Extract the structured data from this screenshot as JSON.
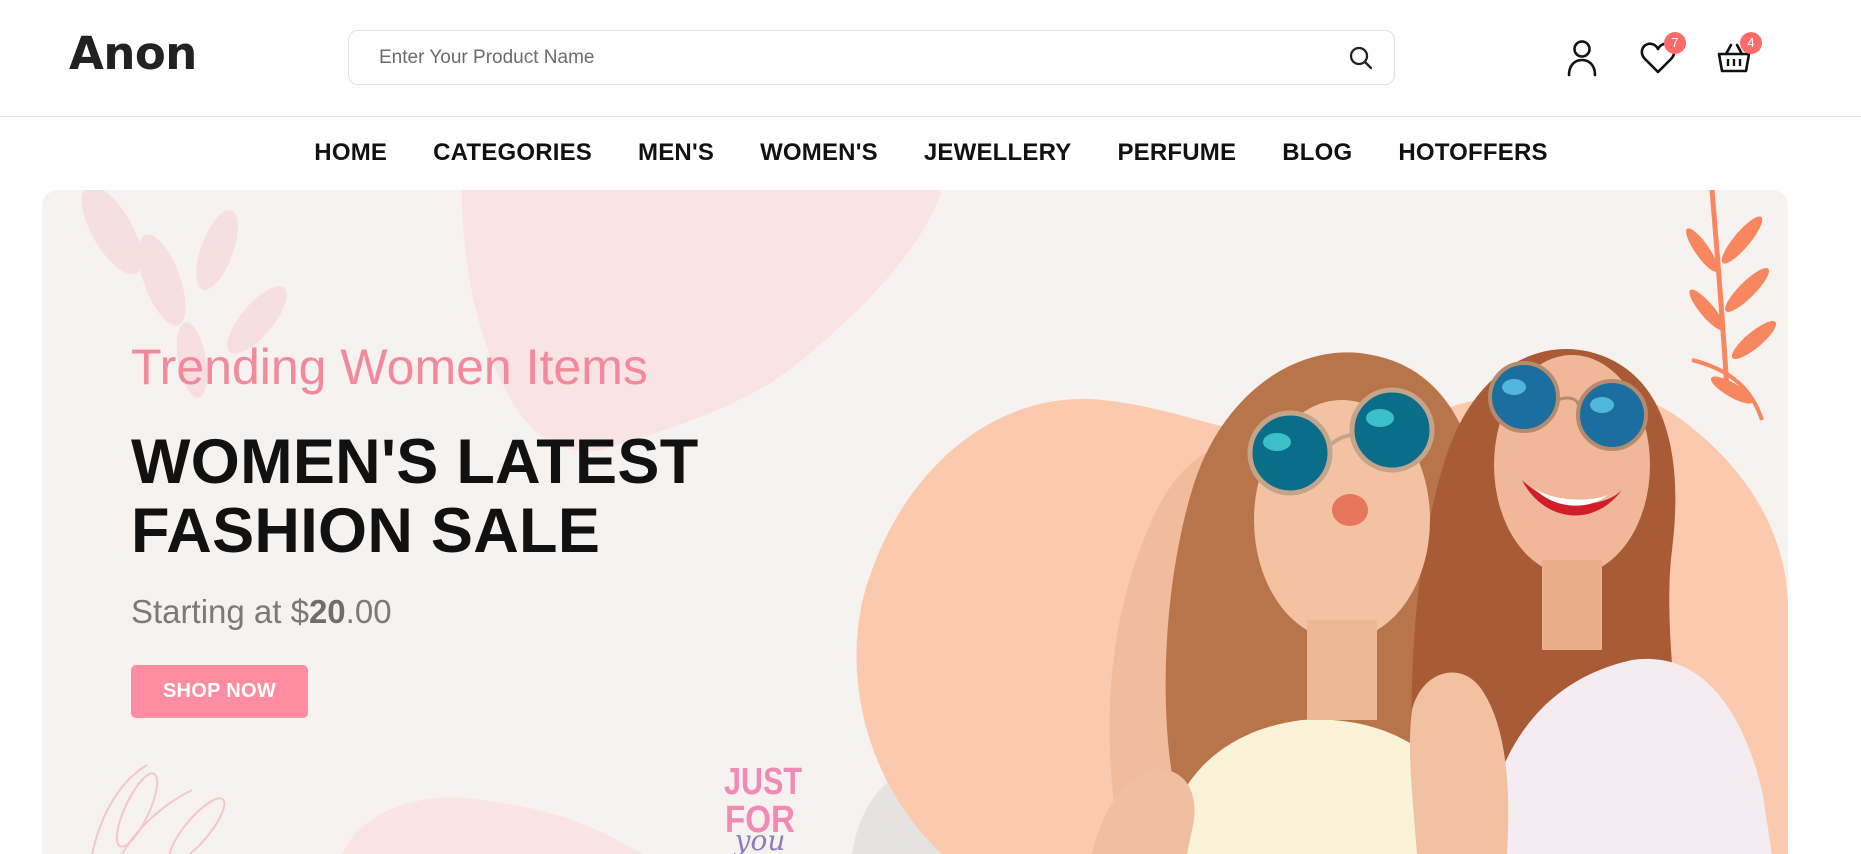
{
  "header": {
    "logo": "Anon",
    "search": {
      "placeholder": "Enter Your Product Name",
      "value": ""
    },
    "actions": {
      "account_icon": "user-icon",
      "wishlist_icon": "heart-icon",
      "wishlist_count": "7",
      "cart_icon": "basket-icon",
      "cart_count": "4"
    }
  },
  "nav": {
    "items": [
      {
        "label": "HOME"
      },
      {
        "label": "CATEGORIES"
      },
      {
        "label": "MEN'S"
      },
      {
        "label": "WOMEN'S"
      },
      {
        "label": "JEWELLERY"
      },
      {
        "label": "PERFUME"
      },
      {
        "label": "BLOG"
      },
      {
        "label": "HOTOFFERS"
      }
    ]
  },
  "banner": {
    "subtitle": "Trending Women Items",
    "title_line1": "WOMEN'S LATEST",
    "title_line2": "FASHION SALE",
    "price_prefix": "Starting at $",
    "price_whole": "20",
    "price_cents": ".00",
    "cta_label": "SHOP NOW",
    "decor_text_1": "JUST",
    "decor_text_2": "FOR",
    "decor_text_3": "you",
    "image_description": "two-women-sunglasses-photo"
  },
  "colors": {
    "accent": "#ff8da1",
    "subtitle": "#f28a9c",
    "badge": "#ff6b6b",
    "banner_bg": "#f5f2ef",
    "peach": "#fbc9ad"
  }
}
